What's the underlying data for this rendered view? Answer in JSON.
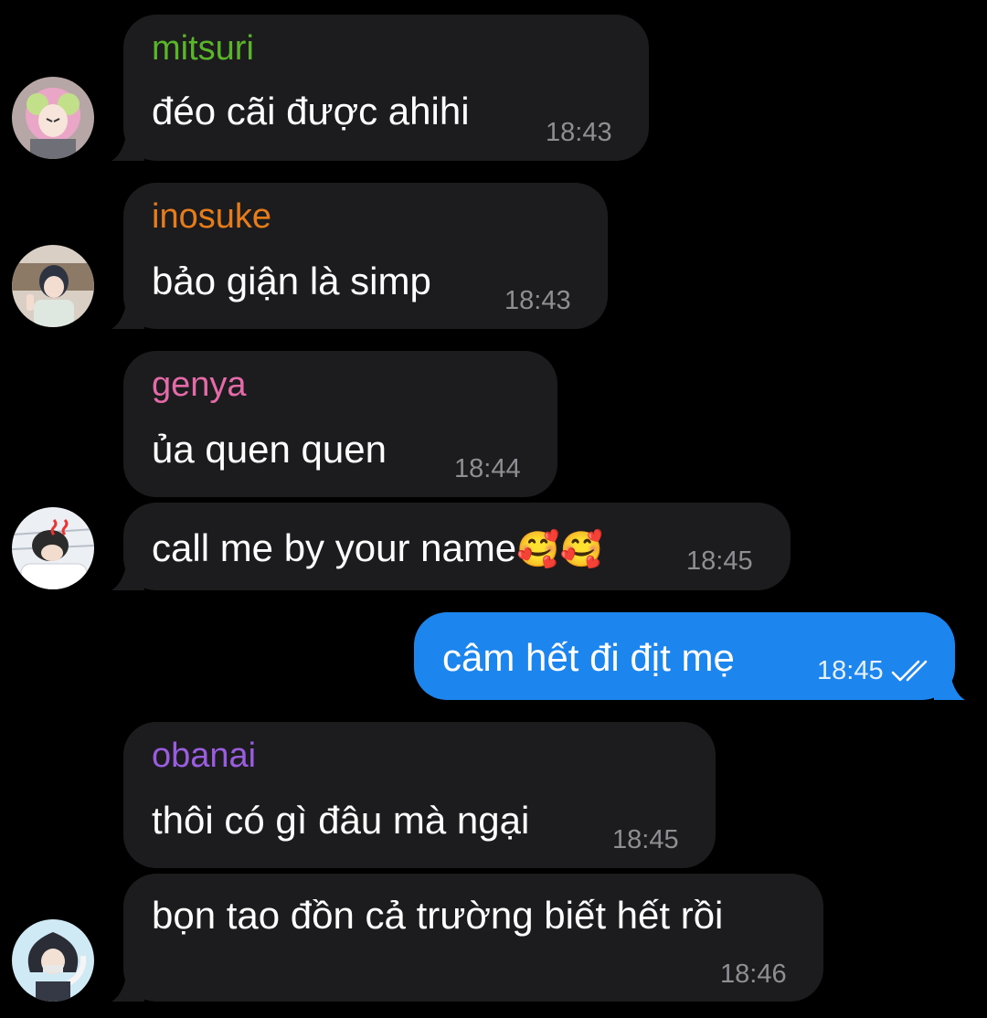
{
  "messages": [
    {
      "sender": "mitsuri",
      "sender_color": "#5bb52a",
      "text": "đéo cãi được ahihi",
      "time": "18:43",
      "avatar": "avatar-mitsuri"
    },
    {
      "sender": "inosuke",
      "sender_color": "#e77c1a",
      "text": "bảo giận là simp",
      "time": "18:43",
      "avatar": "avatar-inosuke"
    },
    {
      "sender": "genya",
      "sender_color": "#e46aa8",
      "text": "ủa quen quen",
      "time": "18:44"
    },
    {
      "text": "call me by your name",
      "emoji": "🥰🥰",
      "time": "18:45",
      "avatar": "avatar-genya"
    },
    {
      "outgoing": true,
      "text": "câm hết đi địt mẹ",
      "time": "18:45",
      "status": "read"
    },
    {
      "sender": "obanai",
      "sender_color": "#9a5de0",
      "text": "thôi có gì đâu mà ngại",
      "time": "18:45"
    },
    {
      "text": "bọn tao đồn cả trường biết hết rồi",
      "time": "18:46",
      "avatar": "avatar-obanai"
    }
  ],
  "colors": {
    "background": "#000000",
    "incoming_bubble": "#1c1c1e",
    "outgoing_bubble": "#1c86ee",
    "timestamp": "#8e8e93"
  }
}
